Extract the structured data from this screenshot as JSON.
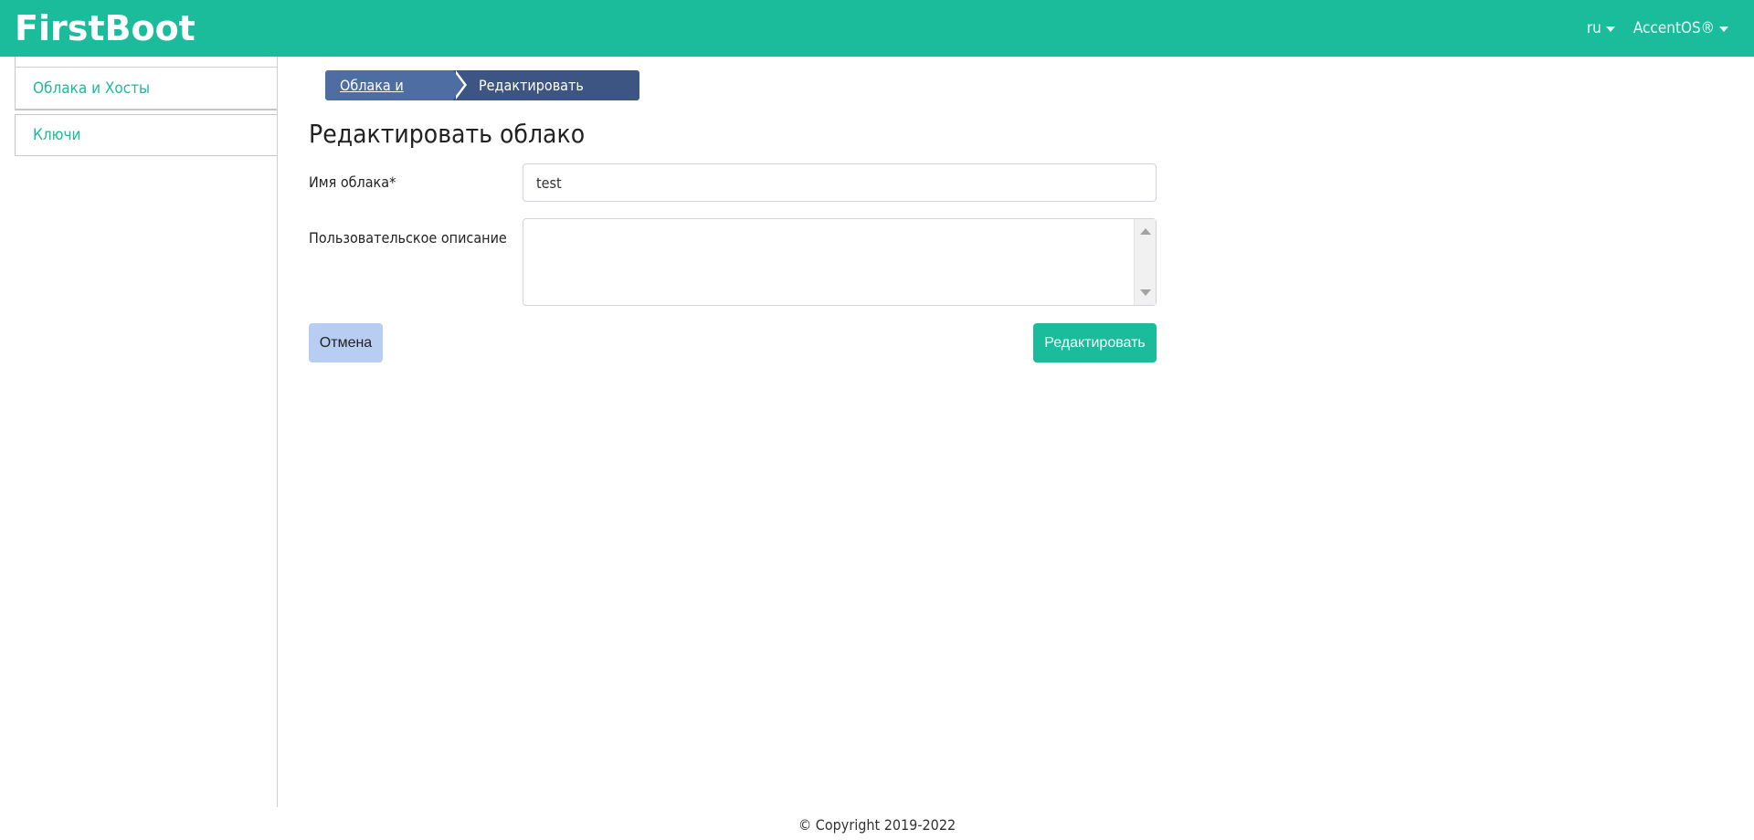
{
  "header": {
    "brand": "FirstBoot",
    "language": "ru",
    "user": "AccentOS®",
    "accent_color": "#1abc9c"
  },
  "sidebar": {
    "items": [
      {
        "label": "Облака и Хосты",
        "active": true
      },
      {
        "label": "Ключи",
        "active": false
      }
    ]
  },
  "breadcrumb": {
    "parent": "Облака и Хосты",
    "current": "Редактировать облако"
  },
  "page": {
    "title": "Редактировать облако"
  },
  "form": {
    "name_label": "Имя облака*",
    "name_value": "test",
    "description_label": "Пользовательское описание",
    "description_value": "",
    "cancel_label": "Отмена",
    "submit_label": "Редактировать"
  },
  "footer": {
    "copyright": "© Copyright 2019-2022"
  }
}
